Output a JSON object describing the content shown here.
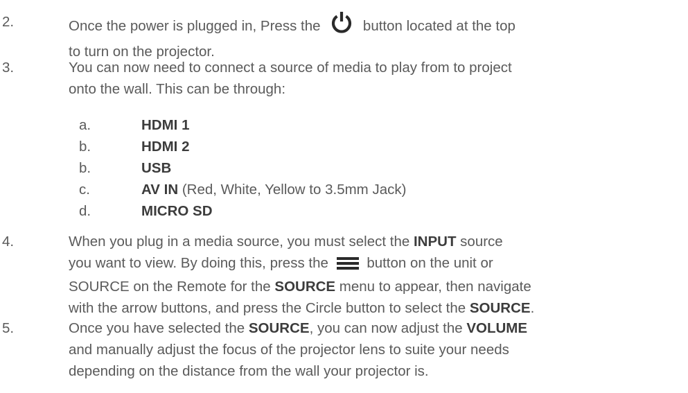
{
  "colors": {
    "text": "#5a5a5a",
    "bold": "#3c3c3c",
    "icon": "#2a2a2a"
  },
  "steps": [
    {
      "number": "2.",
      "line1_a": "Once the power is plugged in, Press the",
      "icon": "power-icon",
      "line1_b": "button located at the top",
      "line2": "to turn on the projector."
    },
    {
      "number": "3.",
      "line1": "You can now need to connect a source of media to play from to project",
      "line2": "onto the wall. This can be through:",
      "options": [
        {
          "letter": "a.",
          "bold": "HDMI 1",
          "rest": ""
        },
        {
          "letter": "b.",
          "bold": "HDMI 2",
          "rest": ""
        },
        {
          "letter": "b.",
          "bold": "USB",
          "rest": ""
        },
        {
          "letter": "c.",
          "bold": "AV IN",
          "rest": " (Red, White, Yellow to 3.5mm Jack)"
        },
        {
          "letter": "d.",
          "bold": "MICRO SD",
          "rest": ""
        }
      ]
    },
    {
      "number": "4.",
      "l1_a": "When you plug in a media source, you must select the ",
      "l1_b": "INPUT",
      "l1_c": " source",
      "l2_a": "you want to view. By doing this, press the",
      "icon": "menu-icon",
      "l2_b": "button on the unit or",
      "l3_a": "SOURCE on the Remote for the ",
      "l3_b": "SOURCE",
      "l3_c": " menu to appear, then navigate",
      "l4_a": "with the arrow buttons, and press the Circle button to select the ",
      "l4_b": "SOURCE",
      "l4_c": "."
    },
    {
      "number": "5.",
      "l1_a": "Once you have selected the ",
      "l1_b": "SOURCE",
      "l1_c": ", you can now adjust the ",
      "l1_d": "VOLUME",
      "l2": "and manually adjust the focus of the projector lens to suite your needs",
      "l3": "depending on the distance from the wall your projector is."
    }
  ]
}
